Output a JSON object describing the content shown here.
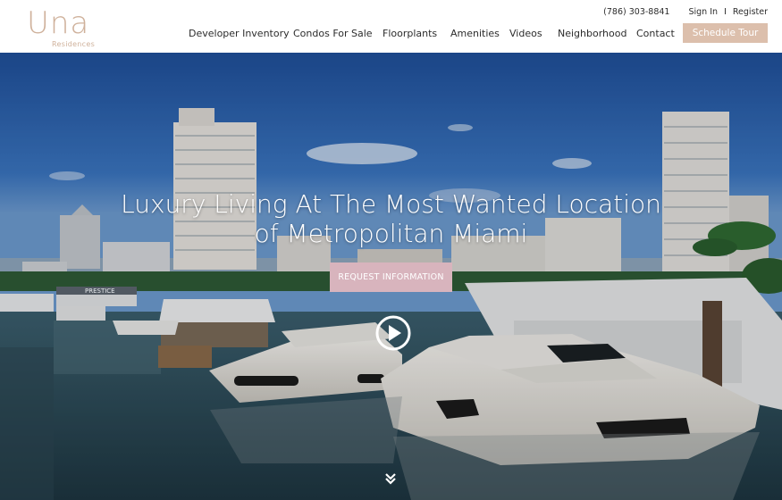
{
  "brand": {
    "logo_text": "Una",
    "logo_subtext": "Residences",
    "logo_color": "#cfb19b"
  },
  "utility": {
    "phone": "(786) 303-8841",
    "sign_in": "Sign In",
    "separator": "I",
    "register": "Register"
  },
  "nav": {
    "items": [
      {
        "label": "Developer Inventory"
      },
      {
        "label": "Condos For Sale"
      },
      {
        "label": "Floorplants"
      },
      {
        "label": "Amenities"
      },
      {
        "label": "Videos"
      },
      {
        "label": "Neighborhood"
      },
      {
        "label": "Contact"
      }
    ],
    "cta_label": "Schedule Tour",
    "cta_color": "#dcbfac"
  },
  "hero": {
    "title_line1": "Luxury Living At The Most Wanted Location",
    "title_line2": "of Metropolitan Miami",
    "request_button": "REQUEST INFORMATION",
    "request_color": "#d8b4bd",
    "sign_text": "PRESTICE",
    "play_icon": "play-circle-icon",
    "scroll_icon": "double-chevron-down-icon"
  }
}
